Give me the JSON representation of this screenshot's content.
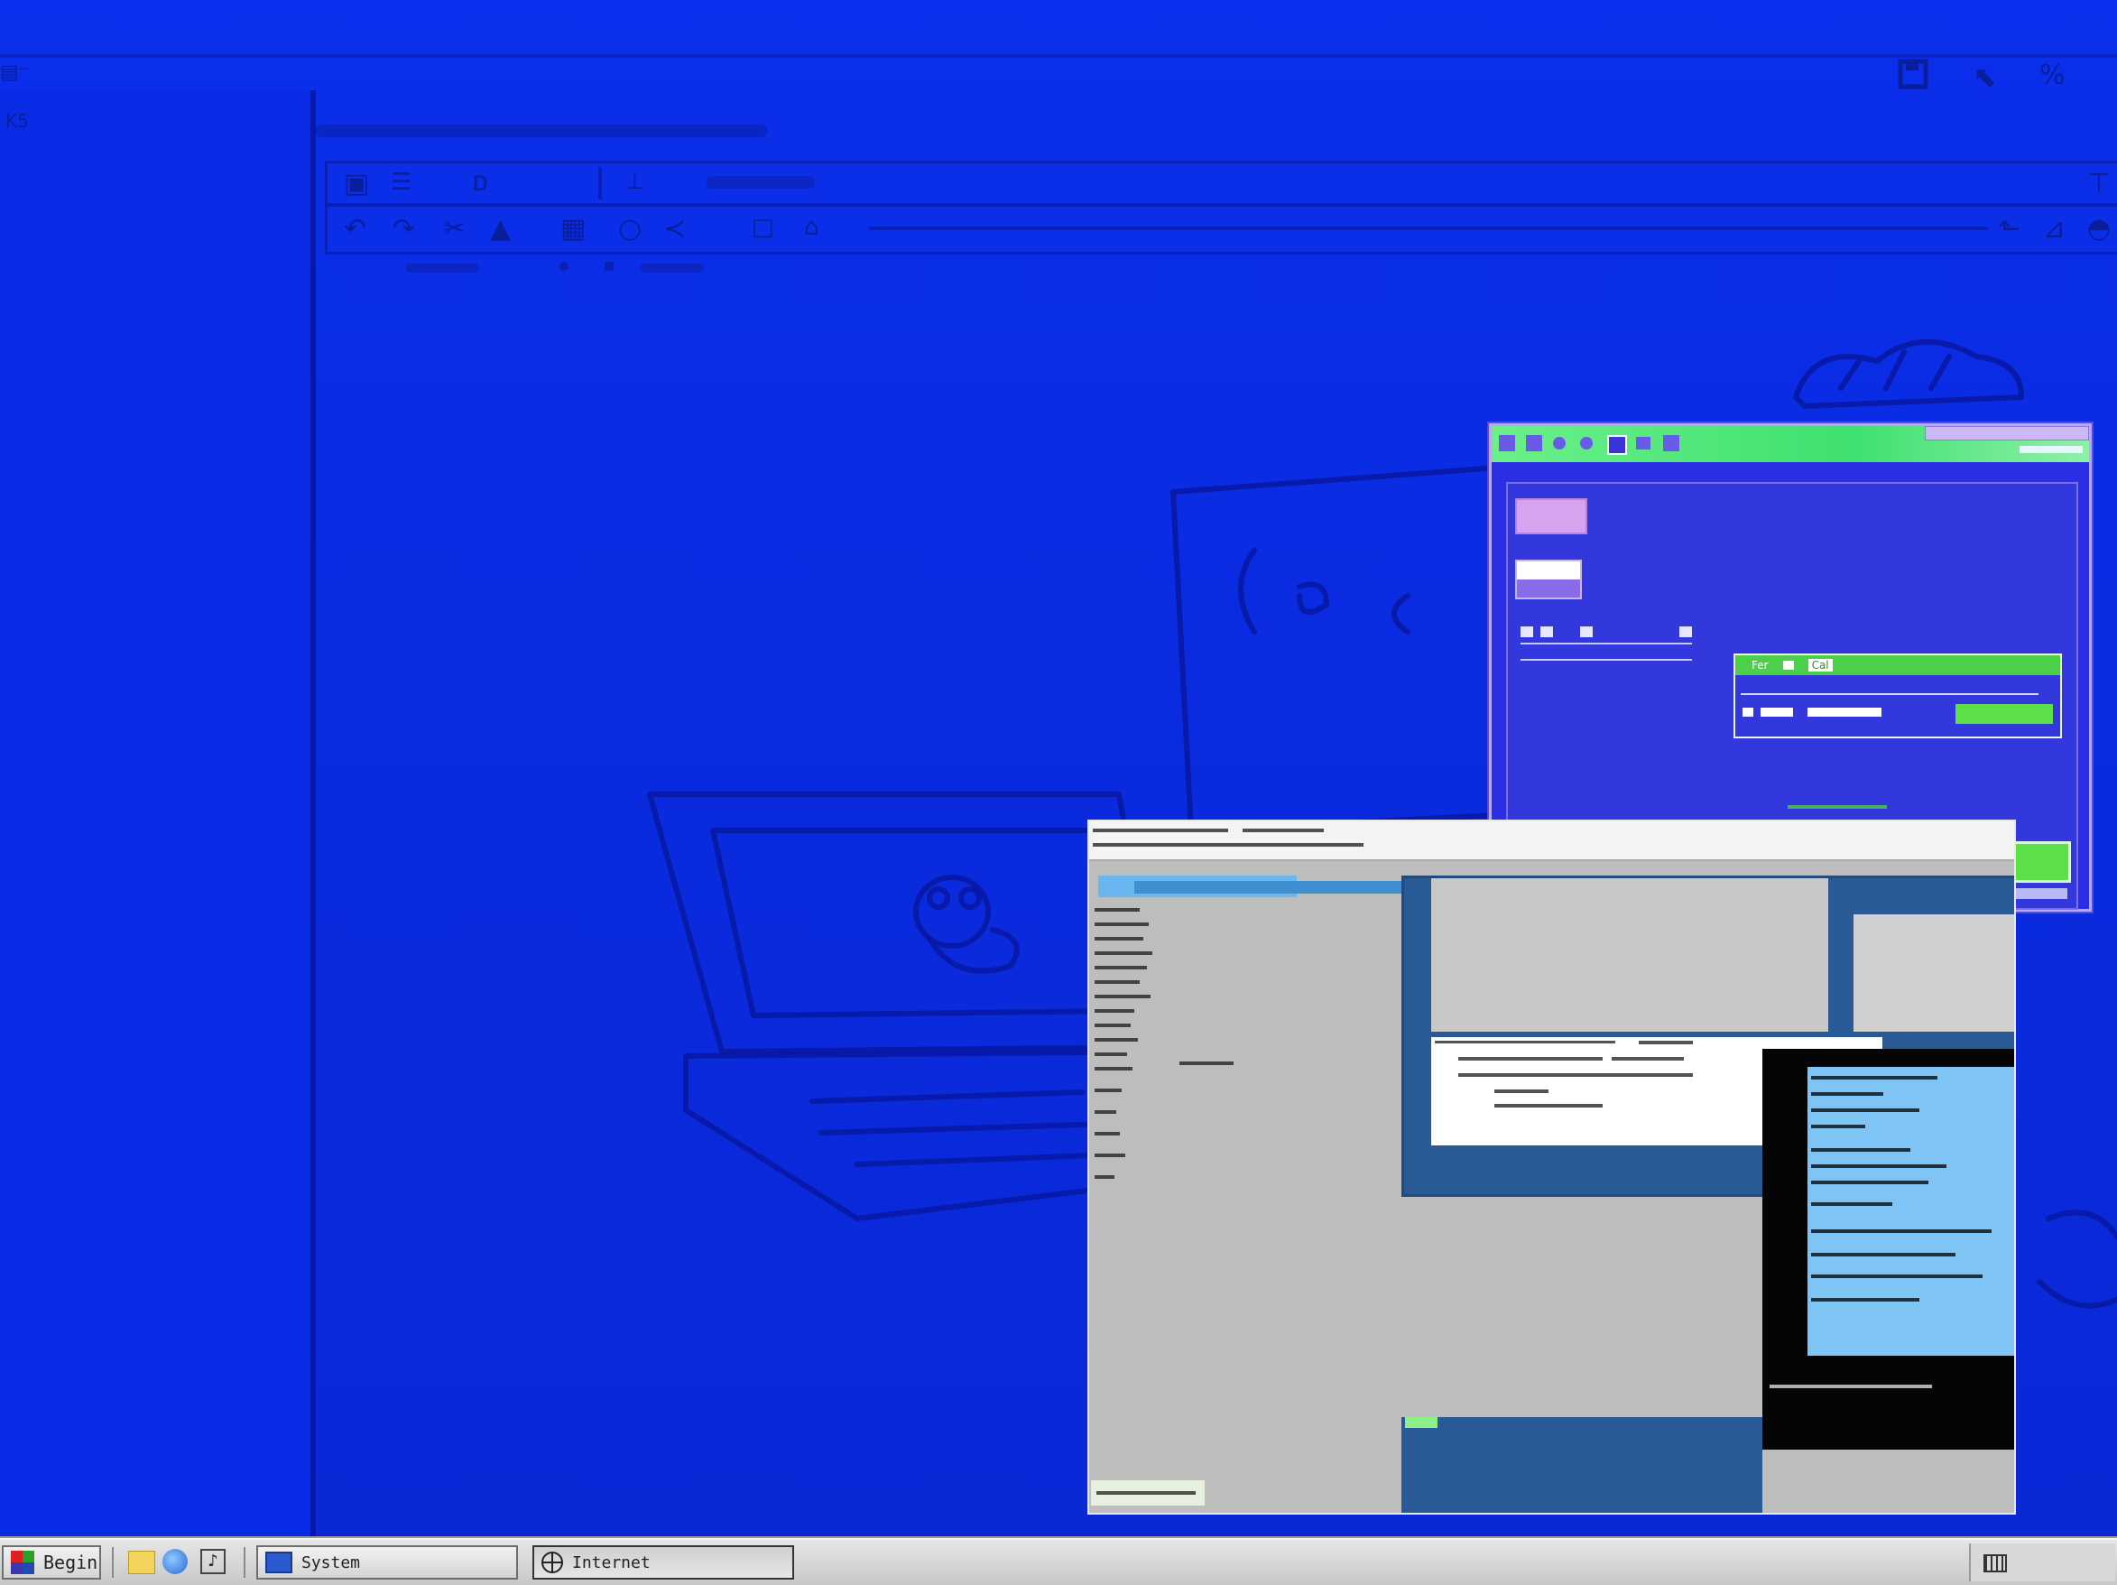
{
  "taskbar": {
    "start_label": "Begin",
    "tasks": [
      {
        "label": "System"
      },
      {
        "label": "Internet"
      }
    ],
    "quick_launch": [
      "folder-icon",
      "globe-icon",
      "music-note-icon"
    ],
    "tray": "keyboard-icon"
  },
  "colors": {
    "desktop": "#0a2ee6",
    "popup_title": "#4ee47a",
    "popup_button_green": "#5ce048",
    "popup_button_lilac": "#d6a3ee",
    "taskbar": "#d4d4d4"
  },
  "main_window": {
    "left_label": "K5"
  },
  "popup": {
    "inner_titlebar_labels": [
      "Fer",
      "Cal"
    ]
  }
}
